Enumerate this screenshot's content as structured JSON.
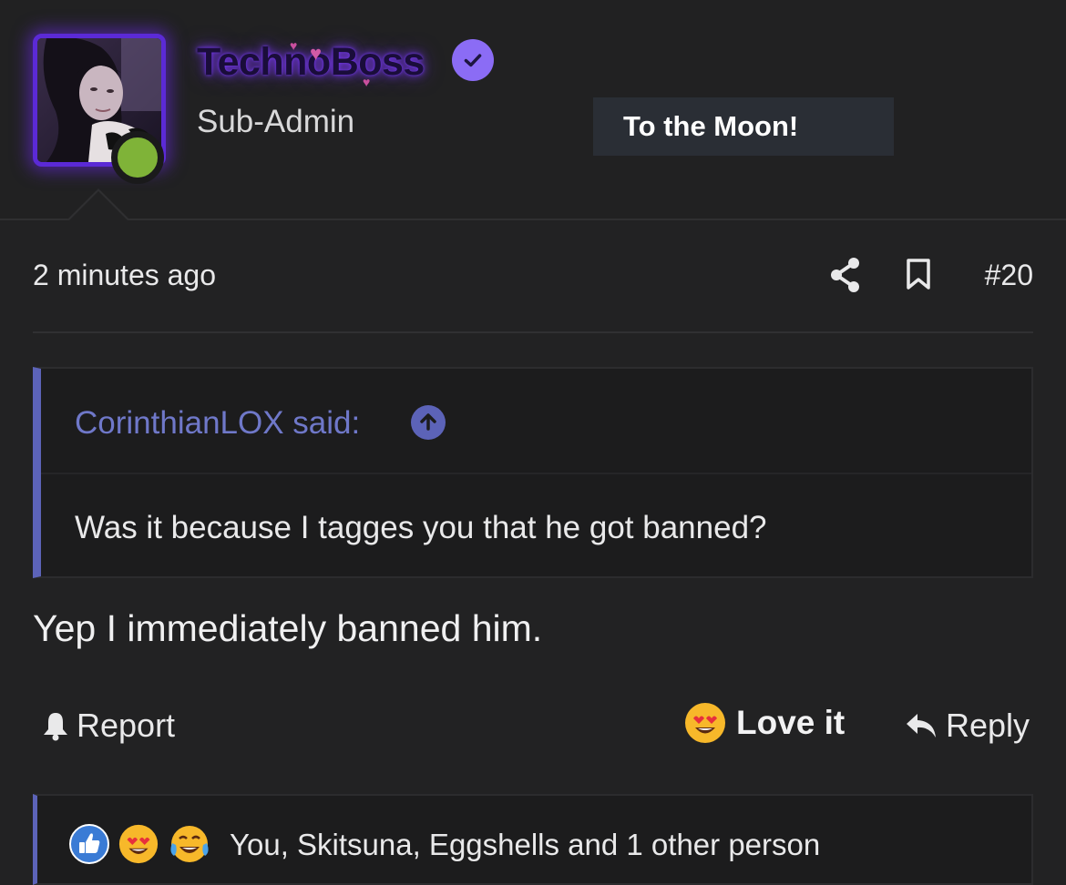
{
  "user": {
    "username": "TechnoBoss",
    "title": "Sub-Admin",
    "banner": "To the Moon!",
    "online": true,
    "verified": true
  },
  "post": {
    "time": "2 minutes ago",
    "number": "#20",
    "body": "Yep I immediately banned him."
  },
  "quote": {
    "author": "CorinthianLOX said:",
    "text": "Was it because I tagges you that he got banned?"
  },
  "actions": {
    "report": "Report",
    "love": "Love it",
    "reply": "Reply"
  },
  "reactions": {
    "icons": [
      "like-icon",
      "heart-eyes-icon",
      "tears-of-joy-icon"
    ],
    "summary": "You, Skitsuna, Eggshells and 1 other person"
  },
  "colors": {
    "background": "#222223",
    "accent": "#5c63b8",
    "verified": "#8b6cf5",
    "online": "#7fb338",
    "username_glow": "#6d3bf0"
  }
}
